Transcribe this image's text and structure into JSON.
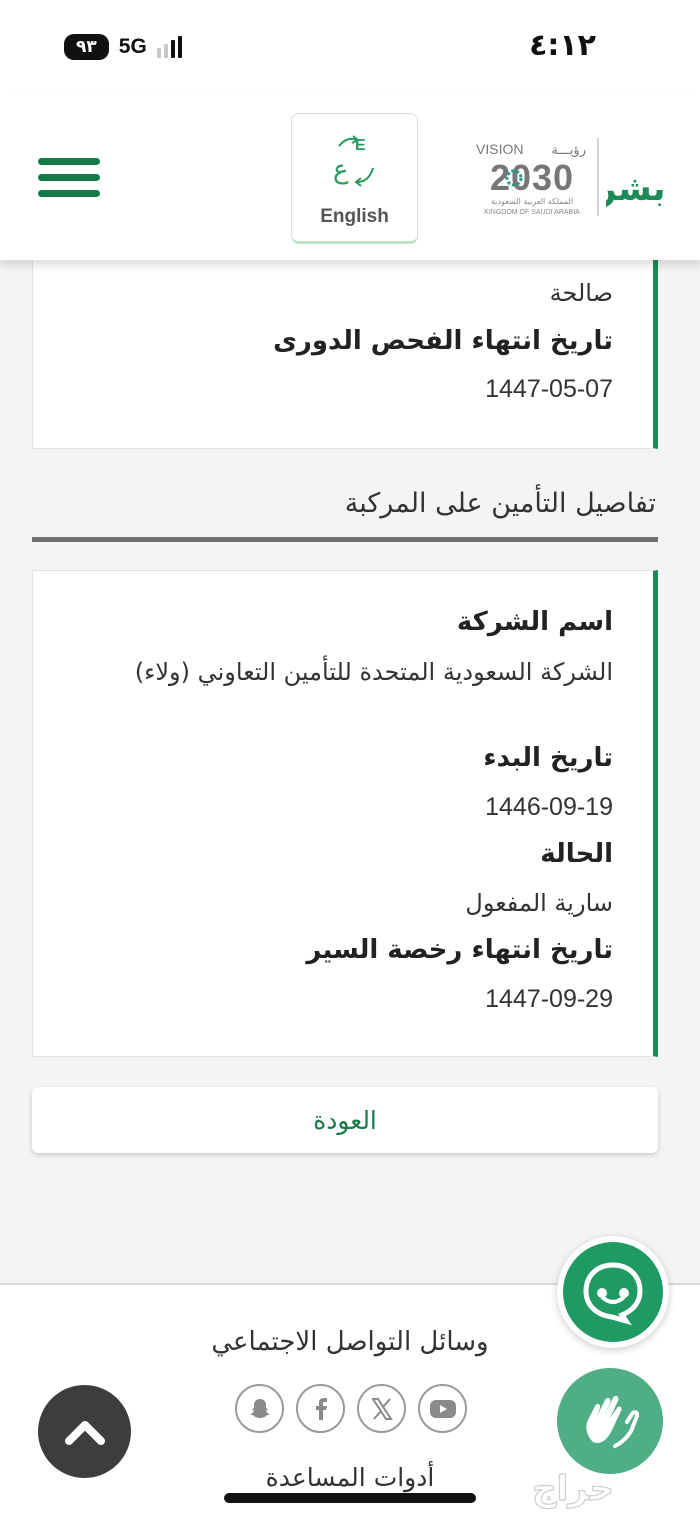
{
  "status_bar": {
    "battery": "٩٣",
    "network": "5G",
    "time": "٤:١٢"
  },
  "header": {
    "language_button_label": "English",
    "vision_logo": {
      "arabic": "رؤيـــة",
      "word": "VISION",
      "year": "2030",
      "country_ar": "المملكة العربية السعودية",
      "country_en": "KINGDOM OF SAUDI ARABIA"
    },
    "brand_logo_text": "أبشر"
  },
  "inspection_card": {
    "status_value": "صالحة",
    "expiry_label": "تاريخ انتهاء الفحص الدورى",
    "expiry_value": "1447-05-07"
  },
  "insurance_section": {
    "title": "تفاصيل التأمين على المركبة",
    "company_label": "اسم الشركة",
    "company_value": "الشركة السعودية المتحدة للتأمين التعاوني (ولاء)",
    "start_label": "تاريخ البدء",
    "start_value": "1446-09-19",
    "status_label": "الحالة",
    "status_value": "سارية المفعول",
    "license_expiry_label": "تاريخ انتهاء رخصة السير",
    "license_expiry_value": "1447-09-29"
  },
  "back_button_label": "العودة",
  "footer": {
    "social_title": "وسائل التواصل الاجتماعي",
    "social_icons": [
      "snapchat-icon",
      "facebook-icon",
      "x-icon",
      "youtube-icon"
    ],
    "tools_title": "أدوات المساعدة"
  },
  "watermark_text": "حراج",
  "colors": {
    "brand_green": "#1c8a55",
    "menu_green": "#147a4a",
    "back_text": "#1c7a48"
  }
}
